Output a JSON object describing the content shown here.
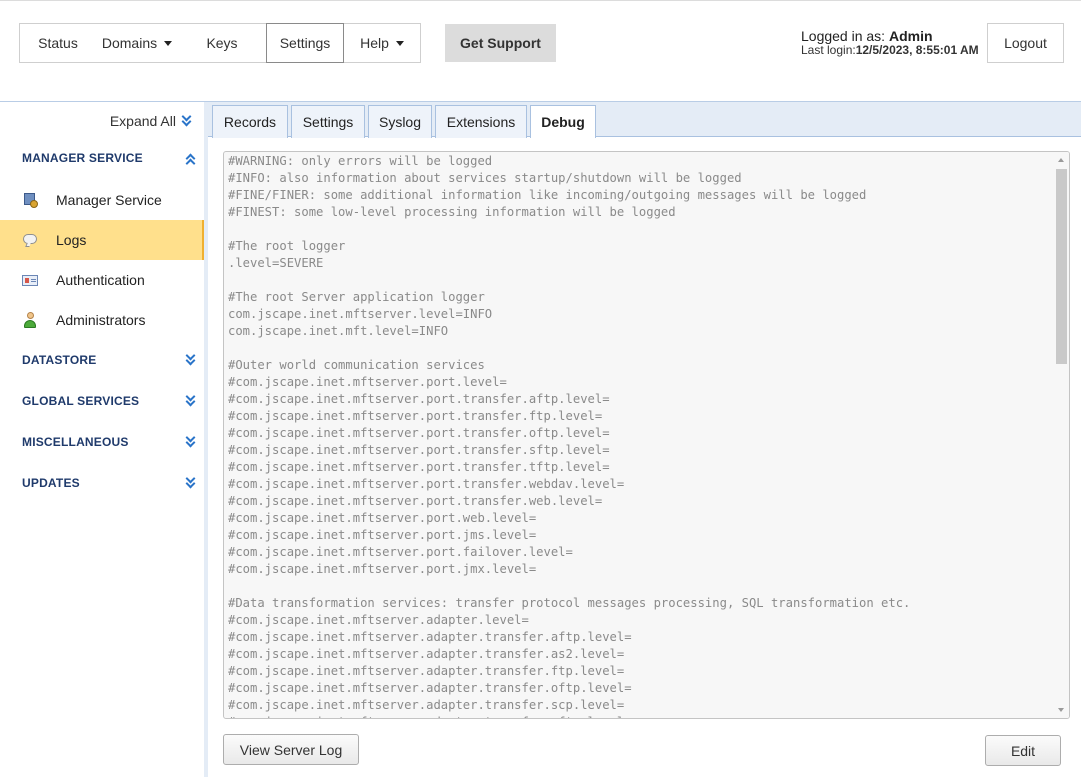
{
  "nav": {
    "status": "Status",
    "domains": "Domains",
    "keys": "Keys",
    "settings": "Settings",
    "help": "Help",
    "support": "Get Support"
  },
  "user": {
    "logged_in_prefix": "Logged in as:",
    "name": "Admin",
    "last_login_prefix": "Last login:",
    "last_login": "12/5/2023, 8:55:01 AM",
    "logout": "Logout"
  },
  "sidebar": {
    "expand_all": "Expand All",
    "sections": {
      "manager_service": "MANAGER SERVICE",
      "datastore": "DATASTORE",
      "global_services": "GLOBAL SERVICES",
      "miscellaneous": "MISCELLANEOUS",
      "updates": "UPDATES"
    },
    "items": [
      "Manager Service",
      "Logs",
      "Authentication",
      "Administrators"
    ]
  },
  "tabs": [
    "Records",
    "Settings",
    "Syslog",
    "Extensions",
    "Debug"
  ],
  "editor": {
    "content": "#WARNING: only errors will be logged\n#INFO: also information about services startup/shutdown will be logged\n#FINE/FINER: some additional information like incoming/outgoing messages will be logged\n#FINEST: some low-level processing information will be logged\n\n#The root logger\n.level=SEVERE\n\n#The root Server application logger\ncom.jscape.inet.mftserver.level=INFO\ncom.jscape.inet.mft.level=INFO\n\n#Outer world communication services\n#com.jscape.inet.mftserver.port.level=\n#com.jscape.inet.mftserver.port.transfer.aftp.level=\n#com.jscape.inet.mftserver.port.transfer.ftp.level=\n#com.jscape.inet.mftserver.port.transfer.oftp.level=\n#com.jscape.inet.mftserver.port.transfer.sftp.level=\n#com.jscape.inet.mftserver.port.transfer.tftp.level=\n#com.jscape.inet.mftserver.port.transfer.webdav.level=\n#com.jscape.inet.mftserver.port.transfer.web.level=\n#com.jscape.inet.mftserver.port.web.level=\n#com.jscape.inet.mftserver.port.jms.level=\n#com.jscape.inet.mftserver.port.failover.level=\n#com.jscape.inet.mftserver.port.jmx.level=\n\n#Data transformation services: transfer protocol messages processing, SQL transformation etc.\n#com.jscape.inet.mftserver.adapter.level=\n#com.jscape.inet.mftserver.adapter.transfer.aftp.level=\n#com.jscape.inet.mftserver.adapter.transfer.as2.level=\n#com.jscape.inet.mftserver.adapter.transfer.ftp.level=\n#com.jscape.inet.mftserver.adapter.transfer.oftp.level=\n#com.jscape.inet.mftserver.adapter.transfer.scp.level=\n#com.jscape.inet.mftserver.adapter.transfer.sftp.level="
  },
  "buttons": {
    "view_server_log": "View Server Log",
    "edit": "Edit"
  },
  "colors": {
    "active_item": "#ffe08c",
    "section_header": "#1f3a6b",
    "chevron": "#2a74c9",
    "tab_bar": "#e4ecf6"
  }
}
